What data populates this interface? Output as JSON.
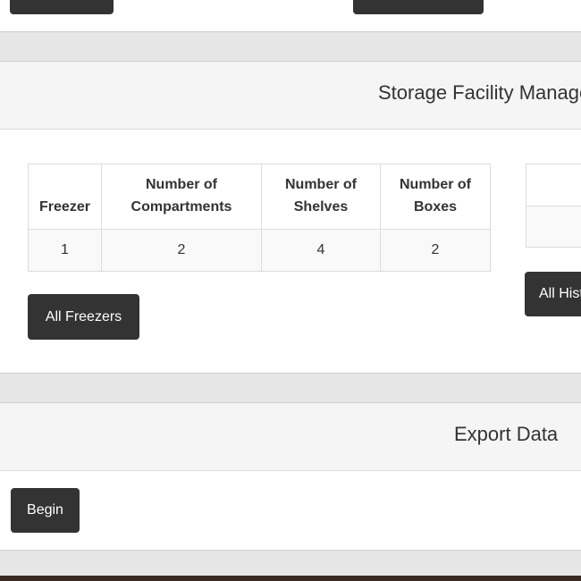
{
  "storage_panel": {
    "title": "Storage Facility Management",
    "table": {
      "headers": [
        "Freezer",
        "Number of Compartments",
        "Number of Shelves",
        "Number of Boxes"
      ],
      "rows": [
        [
          "1",
          "2",
          "4",
          "2"
        ]
      ]
    },
    "all_freezers_label": "All Freezers",
    "all_history_label": "All History"
  },
  "export_panel": {
    "title": "Export Data",
    "begin_label": "Begin"
  },
  "colors": {
    "button_bg": "#333333",
    "heading_bg": "#f5f5f5",
    "page_bg": "#e6e6e6"
  }
}
